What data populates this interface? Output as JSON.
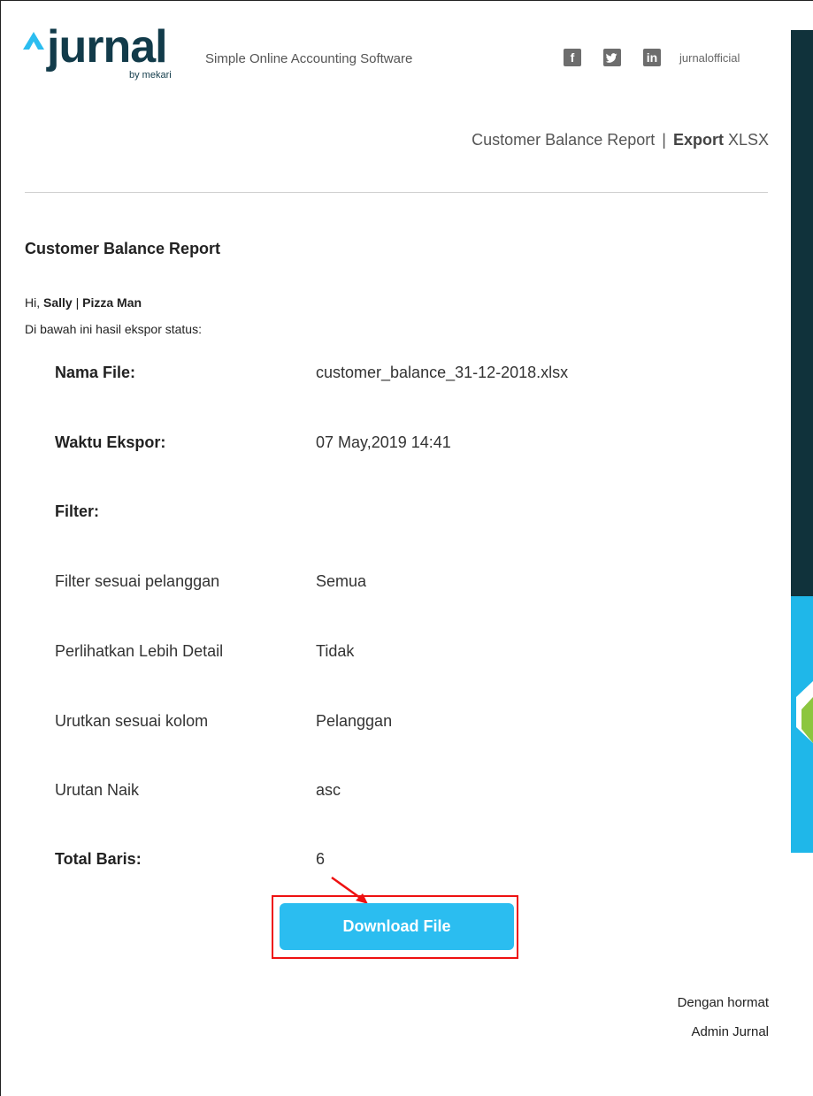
{
  "brand": {
    "name": "jurnal",
    "sub": "by mekari",
    "tagline": "Simple Online Accounting Software",
    "social_handle": "jurnalofficial",
    "social_icons": [
      "facebook-icon",
      "twitter-icon",
      "linkedin-icon"
    ]
  },
  "header": {
    "report_name": "Customer Balance Report",
    "separator": "|",
    "export_bold": "Export",
    "export_format": "XLSX"
  },
  "body": {
    "heading": "Customer Balance Report",
    "greeting_prefix": "Hi, ",
    "user_name": "Sally",
    "greeting_sep": " | ",
    "company_name": "Pizza Man",
    "intro": "Di bawah ini hasil ekspor status:"
  },
  "details": [
    {
      "label": "Nama File:",
      "value": "customer_balance_31-12-2018.xlsx"
    },
    {
      "label": "Waktu Ekspor:",
      "value": "07 May,2019 14:41"
    },
    {
      "label": "Filter:",
      "value": ""
    },
    {
      "label": "Filter sesuai pelanggan",
      "value": "Semua"
    },
    {
      "label": "Perlihatkan Lebih Detail",
      "value": "Tidak"
    },
    {
      "label": "Urutkan sesuai kolom",
      "value": "Pelanggan"
    },
    {
      "label": "Urutan Naik",
      "value": "asc"
    },
    {
      "label": "Total Baris:",
      "value": "6"
    }
  ],
  "download": {
    "label": "Download File"
  },
  "closing": {
    "line1": "Dengan hormat",
    "line2": "Admin Jurnal"
  },
  "colors": {
    "brand_dark": "#123b4a",
    "button": "#2bbdf0",
    "highlight": "#e11111"
  }
}
